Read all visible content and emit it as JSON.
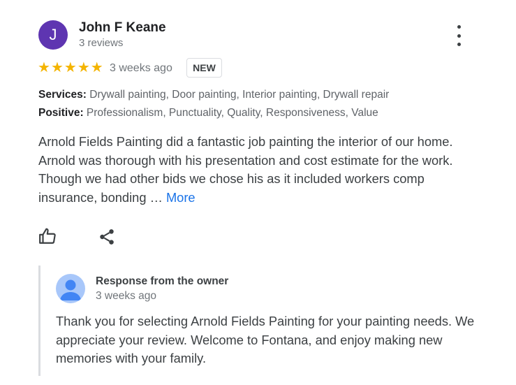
{
  "review": {
    "author_initial": "J",
    "author_name": "John F Keane",
    "author_reviews": "3 reviews",
    "rating": 5,
    "date": "3 weeks ago",
    "badge": "NEW",
    "services_label": "Services:",
    "services_value": "Drywall painting, Door painting, Interior painting, Drywall repair",
    "positive_label": "Positive:",
    "positive_value": "Professionalism, Punctuality, Quality, Responsiveness, Value",
    "text": "Arnold Fields Painting did a fantastic job painting the interior of our home. Arnold was thorough with his presentation and cost estimate for the work. Though we had other bids we chose his as it included workers comp insurance, bonding … ",
    "more_label": "More"
  },
  "actions": {
    "like_icon": "thumbs-up-icon",
    "share_icon": "share-icon",
    "menu_icon": "more-vert-icon"
  },
  "owner_response": {
    "title": "Response from the owner",
    "date": "3 weeks ago",
    "text": "Thank you for selecting Arnold Fields Painting for your painting needs. We appreciate your review. Welcome to Fontana, and enjoy making new memories with your family."
  },
  "colors": {
    "avatar": "#5e35b1",
    "star": "#f4b400",
    "link": "#1a73e8",
    "owner_avatar_bg": "#a8c7fa",
    "owner_avatar_fg": "#4285f4"
  }
}
